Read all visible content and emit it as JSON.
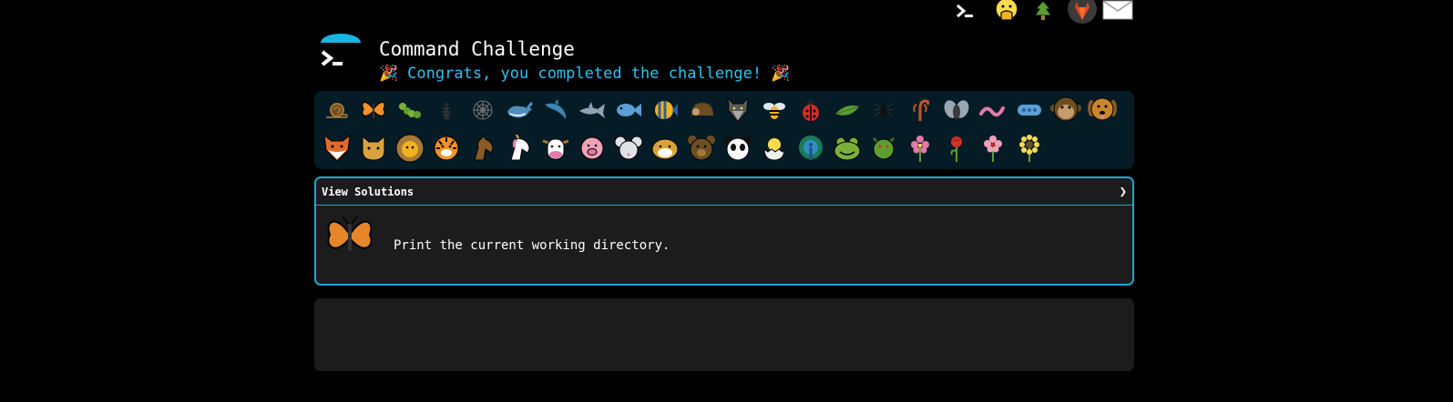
{
  "nav": {
    "icons": [
      "terminal-icon",
      "face-with-hand-over-mouth-icon",
      "christmas-tree-icon",
      "gitlab-icon",
      "envelope-icon"
    ]
  },
  "header": {
    "title": "Command Challenge",
    "subtitle": "Congrats, you completed the challenge!",
    "party_left": "🎉",
    "party_right": "🎉"
  },
  "critters": {
    "row1": [
      "snail",
      "butterfly",
      "caterpillar",
      "ant",
      "spider-web",
      "whale",
      "dolphin",
      "shark",
      "fish",
      "tropical-fish",
      "hedgehog",
      "wolf",
      "bee",
      "ladybug",
      "leaf",
      "spider",
      "scorpion",
      "fly",
      "worm",
      "microbe",
      "monkey",
      "dog"
    ],
    "row2": [
      "fox",
      "cat",
      "lion",
      "tiger",
      "horse",
      "unicorn",
      "cow",
      "pig",
      "mouse",
      "hamster",
      "bear",
      "panda",
      "hatching-chick",
      "peacock",
      "frog",
      "dragon",
      "cherry-blossom",
      "rose",
      "hibiscus",
      "sunflower"
    ]
  },
  "challenge": {
    "view_solutions_label": "View Solutions",
    "chevron": "❯",
    "description": "Print the current working directory."
  },
  "colors": {
    "accent": "#1da7cf",
    "subtitle": "#2fc2f0",
    "strip_bg": "#051c26",
    "panel_bg": "#1c1c1c"
  }
}
